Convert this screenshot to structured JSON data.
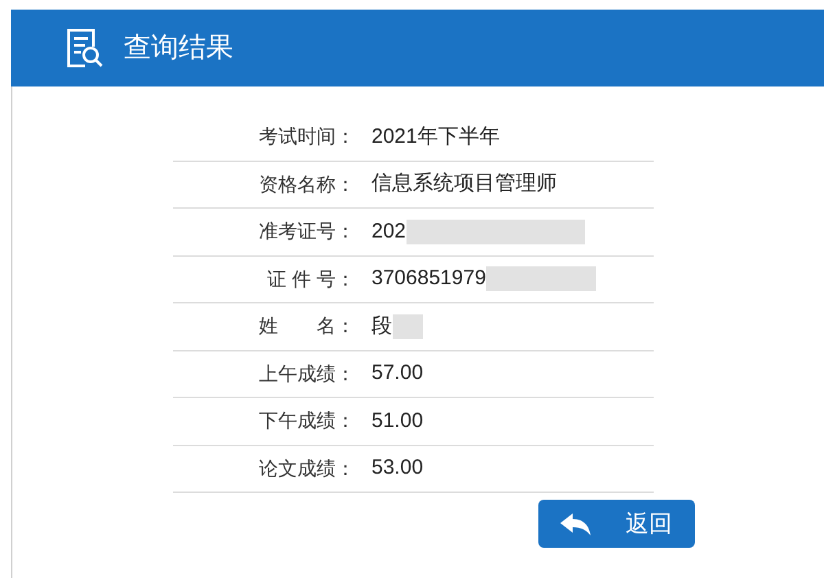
{
  "header": {
    "title": "查询结果"
  },
  "rows": [
    {
      "label": "考试时间：",
      "value": "2021年下半年",
      "kind": "plain"
    },
    {
      "label": "资格名称：",
      "value": "信息系统项目管理师",
      "kind": "plain"
    },
    {
      "label": "准考证号：",
      "value": "202",
      "kind": "longmask"
    },
    {
      "label": "证 件 号：",
      "value": "3706851979",
      "kind": "midmask"
    },
    {
      "label": "姓　　名：",
      "value": "段",
      "kind": "shortmask"
    },
    {
      "label": "上午成绩：",
      "value": "57.00",
      "kind": "plain"
    },
    {
      "label": "下午成绩：",
      "value": "51.00",
      "kind": "plain"
    },
    {
      "label": "论文成绩：",
      "value": "53.00",
      "kind": "plain"
    }
  ],
  "back_button": {
    "label": "返回"
  }
}
